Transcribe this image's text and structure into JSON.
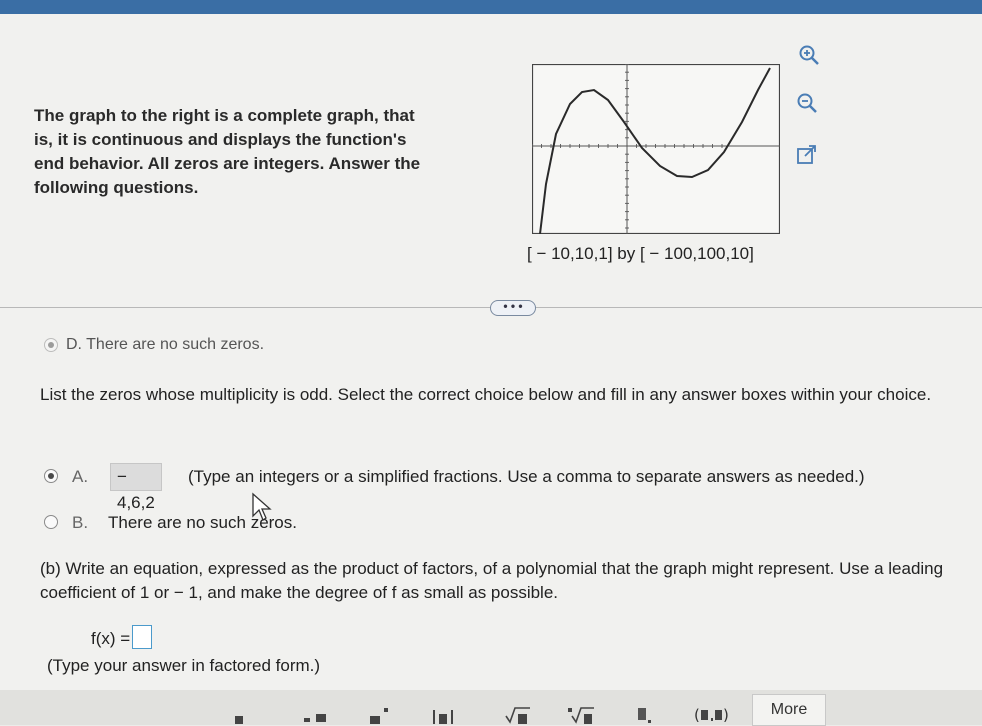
{
  "description": "The graph to the right is a complete graph, that is, it is continuous and displays the function's end behavior. All zeros are integers. Answer the following questions.",
  "graph": {
    "window_label": "[ − 10,10,1] by [ − 100,100,10]",
    "x_range": [
      -10,
      10
    ],
    "x_step": 1,
    "y_range": [
      -100,
      100
    ],
    "y_step": 10,
    "curve_color": "#2a2a2a"
  },
  "tools": [
    "zoom-in-icon",
    "zoom-out-icon",
    "open-external-icon"
  ],
  "expand_label": "• • •",
  "prev_option": "D.   There are no such zeros.",
  "question_a": "List the zeros whose multiplicity is odd. Select the correct choice below and fill in any answer boxes within your choice.",
  "option_a": {
    "letter": "A.",
    "value": "− 4,6,2",
    "text": "(Type an integers or a simplified fractions. Use a comma to separate answers as needed.)",
    "selected": true
  },
  "option_b": {
    "letter": "B.",
    "text": "There are no such zeros.",
    "selected": false
  },
  "question_b": "(b) Write an equation, expressed as the product of factors, of a polynomial that the graph might represent. Use a leading coefficient of 1 or − 1, and make the degree of f as small as possible.",
  "fx_label": "f(x) =",
  "fx_value": "",
  "hint": "(Type your answer in factored form.)",
  "toolbar": {
    "more_label": "More"
  }
}
